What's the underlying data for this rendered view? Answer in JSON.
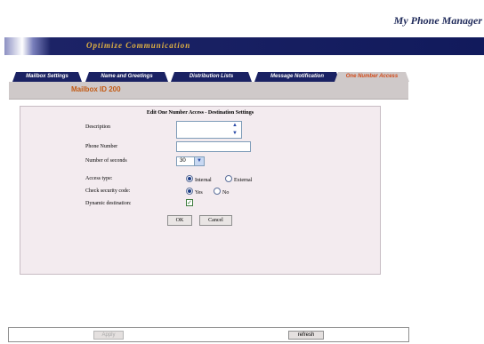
{
  "header": {
    "app_title": "My Phone Manager",
    "banner_text": "Optimize Communication"
  },
  "tabs": [
    {
      "label": "Mailbox Settings"
    },
    {
      "label": "Name and Greetings"
    },
    {
      "label": "Distribution Lists"
    },
    {
      "label": "Message Notification"
    },
    {
      "label": "One Number Access",
      "active": true
    }
  ],
  "subheader": {
    "mailbox_label": "Mailbox ID 200"
  },
  "form": {
    "title": "Edit One Number Access - Destination Settings",
    "description": {
      "label": "Description",
      "value": ""
    },
    "phone_number": {
      "label": "Phone Number",
      "value": ""
    },
    "seconds": {
      "label": "Number of seconds",
      "value": "30"
    },
    "access_type": {
      "label": "Access type:",
      "options": [
        "Internal",
        "External"
      ],
      "selected": "Internal"
    },
    "security": {
      "label": "Check security code:",
      "options": [
        "Yes",
        "No"
      ],
      "selected": "Yes"
    },
    "dynamic": {
      "label": "Dynamic destination:",
      "checked": true
    },
    "ok_label": "OK",
    "cancel_label": "Cancel"
  },
  "footer": {
    "apply_label": "Apply",
    "refresh_label": "refresh"
  },
  "colors": {
    "navy": "#1a2263",
    "accent_orange": "#d24a18",
    "panel_bg": "#f3ebef"
  },
  "icons": {
    "spinner_up": "chevron-up-icon",
    "spinner_down": "chevron-down-icon",
    "dropdown": "chevron-down-icon",
    "check": "check-icon"
  }
}
